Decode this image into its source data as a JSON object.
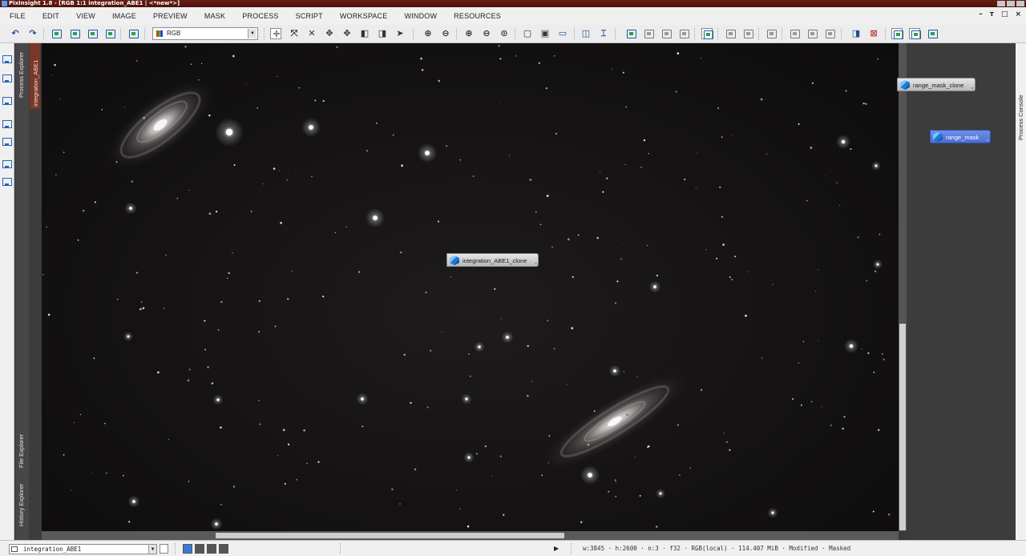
{
  "window": {
    "title": "PixInsight 1.8 - [RGB 1:1 integration_ABE1 | <*new*>]"
  },
  "menu": [
    "FILE",
    "EDIT",
    "VIEW",
    "IMAGE",
    "PREVIEW",
    "MASK",
    "PROCESS",
    "SCRIPT",
    "WORKSPACE",
    "WINDOW",
    "RESOURCES"
  ],
  "toolbar": {
    "channel_select": "RGB"
  },
  "dock_tabs": {
    "process_explorer": "Process Explorer",
    "file_explorer": "File Explorer",
    "history_explorer": "History Explorer",
    "process_console": "Process Console",
    "image_tab": "integration_ABE1"
  },
  "workspace_icons": {
    "clone": "integration_ABE1_clone",
    "range_mask_clone": "range_mask_clone",
    "range_mask": "range_mask"
  },
  "statusbar": {
    "view_name": "integration_ABE1",
    "width": "w:3845",
    "height": "h:2600",
    "channels": "n:3",
    "sample_format": "f32",
    "color_space": "RGB(local)",
    "memory": "114.407 MiB",
    "state_modified": "Modified",
    "state_masked": "Masked",
    "separator": "·"
  },
  "colors": {
    "titlebar": "#5a160f",
    "image_tab_active": "#7a3626",
    "selected_icon": "#5a7ddc"
  },
  "icons": [
    "undo-icon",
    "redo-icon",
    "zoom-in-icon",
    "zoom-out-icon",
    "pan-icon",
    "select-icon",
    "cube-icon",
    "play-icon"
  ]
}
